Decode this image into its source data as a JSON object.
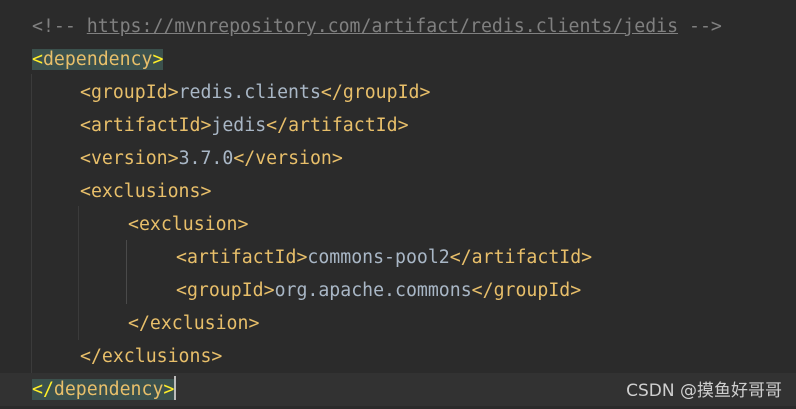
{
  "editor": {
    "comment": {
      "open": "<!-- ",
      "url": "https://mvnrepository.com/artifact/redis.clients/jedis",
      "close": " -->"
    },
    "dependency": {
      "open_lt": "<",
      "tag": "dependency",
      "open_gt": ">",
      "close_lt": "</",
      "close_gt": ">"
    },
    "groupId": {
      "open": "<",
      "tag": "groupId",
      "gt": ">",
      "value": "redis.clients",
      "close_lt": "</",
      "close_gt": ">"
    },
    "artifactId": {
      "open": "<",
      "tag": "artifactId",
      "gt": ">",
      "value": "jedis",
      "close_lt": "</",
      "close_gt": ">"
    },
    "version": {
      "open": "<",
      "tag": "version",
      "gt": ">",
      "value": "3.7.0",
      "close_lt": "</",
      "close_gt": ">"
    },
    "exclusions": {
      "open": "<",
      "tag": "exclusions",
      "gt": ">",
      "close_lt": "</",
      "close_gt": ">"
    },
    "exclusion": {
      "open": "<",
      "tag": "exclusion",
      "gt": ">",
      "close_lt": "</",
      "close_gt": ">"
    },
    "excl_artifactId": {
      "open": "<",
      "tag": "artifactId",
      "gt": ">",
      "value": "commons-pool2",
      "close_lt": "</",
      "close_gt": ">"
    },
    "excl_groupId": {
      "open": "<",
      "tag": "groupId",
      "gt": ">",
      "value": "org.apache.commons",
      "close_lt": "</",
      "close_gt": ">"
    }
  },
  "watermark": "CSDN @摸鱼好哥哥",
  "colors": {
    "background": "#2b2b2b",
    "tag": "#e8bf6a",
    "text": "#a9b7c6",
    "comment": "#808080",
    "match_highlight": "#3b514d"
  }
}
